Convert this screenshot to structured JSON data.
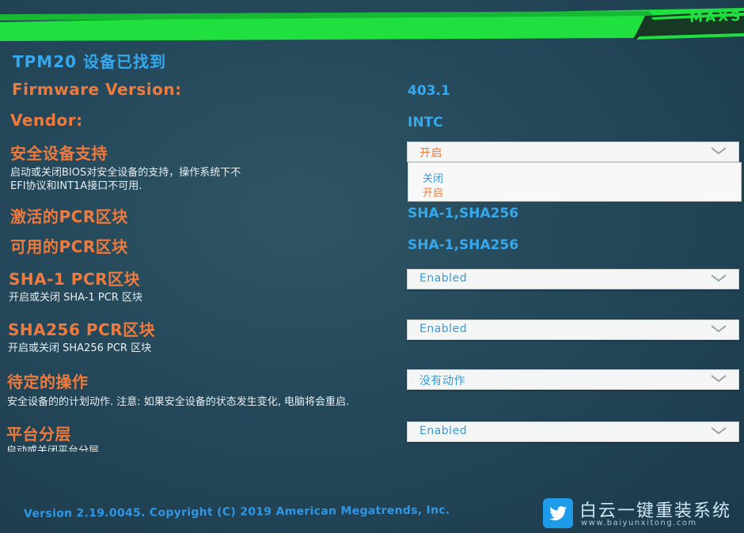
{
  "brand": "MAXS",
  "title": "TPM20 设备已找到",
  "firmware": {
    "label": "Firmware Version:",
    "value": "403.1"
  },
  "vendor": {
    "label": "Vendor:",
    "value": "INTC"
  },
  "security_device_support": {
    "label": "安全设备支持",
    "help": [
      "启动或关闭BIOS对安全设备的支持，操作系统下不",
      "EFI协议和INT1A接口不可用."
    ],
    "selected": "开启",
    "options": [
      "关闭",
      "开启"
    ]
  },
  "active_pcr": {
    "label": "激活的PCR区块",
    "value": "SHA-1,SHA256"
  },
  "available_pcr": {
    "label": "可用的PCR区块",
    "value": "SHA-1,SHA256"
  },
  "sha1_pcr": {
    "label": "SHA-1 PCR区块",
    "help": "开启或关闭 SHA-1 PCR 区块",
    "selected": "Enabled"
  },
  "sha256_pcr": {
    "label": "SHA256 PCR区块",
    "help": "开启或关闭 SHA256 PCR 区块",
    "selected": "Enabled"
  },
  "pending_operation": {
    "label": "待定的操作",
    "help": "安全设备的的计划动作. 注意: 如果安全设备的状态发生变化, 电脑将会重启.",
    "selected": "没有动作"
  },
  "platform_hierarchy": {
    "label": "平台分层",
    "help": "启动或关闭平台分层",
    "selected": "Enabled"
  },
  "footer": "Version 2.19.0045. Copyright (C) 2019 American Megatrends, Inc.",
  "watermark": {
    "title": "白云一键重装系统",
    "url": "www.baiyunxitong.com",
    "icon": "twitter-bird-icon"
  },
  "colors": {
    "green": "#1fe03f",
    "orange": "#ef7a3e",
    "blue": "#35a8ee",
    "background": "#24485a"
  }
}
